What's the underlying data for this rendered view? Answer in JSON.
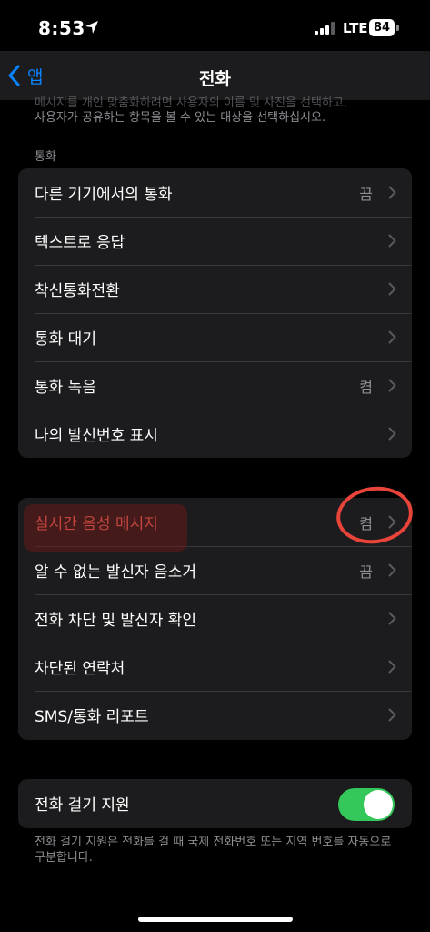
{
  "status": {
    "time": "8:53",
    "network": "LTE",
    "battery": "84"
  },
  "nav": {
    "back_label": "앱",
    "title": "전화"
  },
  "intro": {
    "line1": "메시지를 개인 맞춤화하려면 사용자의 이름 및 사진을 선택하고,",
    "line2": "사용자가 공유하는 항목을 볼 수 있는 대상을 선택하십시오."
  },
  "section_calls": {
    "header": "통화"
  },
  "group1": [
    {
      "label": "다른 기기에서의 통화",
      "value": "끔"
    },
    {
      "label": "텍스트로 응답",
      "value": ""
    },
    {
      "label": "착신통화전환",
      "value": ""
    },
    {
      "label": "통화 대기",
      "value": ""
    },
    {
      "label": "통화 녹음",
      "value": "켬"
    },
    {
      "label": "나의 발신번호 표시",
      "value": ""
    }
  ],
  "group2": [
    {
      "label": "실시간 음성 메시지",
      "value": "켬"
    },
    {
      "label": "알 수 없는 발신자 음소거",
      "value": "끔"
    },
    {
      "label": "전화 차단 및 발신자 확인",
      "value": ""
    },
    {
      "label": "차단된 연락처",
      "value": ""
    },
    {
      "label": "SMS/통화 리포트",
      "value": ""
    }
  ],
  "dial_assist": {
    "label": "전화 걸기 지원",
    "enabled": true,
    "footer": "전화 걸기 지원은 전화를 걸 때 국제 전화번호 또는 지역 번호를 자동으로 구분합니다."
  },
  "colors": {
    "accent": "#0a84ff",
    "toggle_on": "#34c759",
    "annotation": "#e8443a"
  }
}
